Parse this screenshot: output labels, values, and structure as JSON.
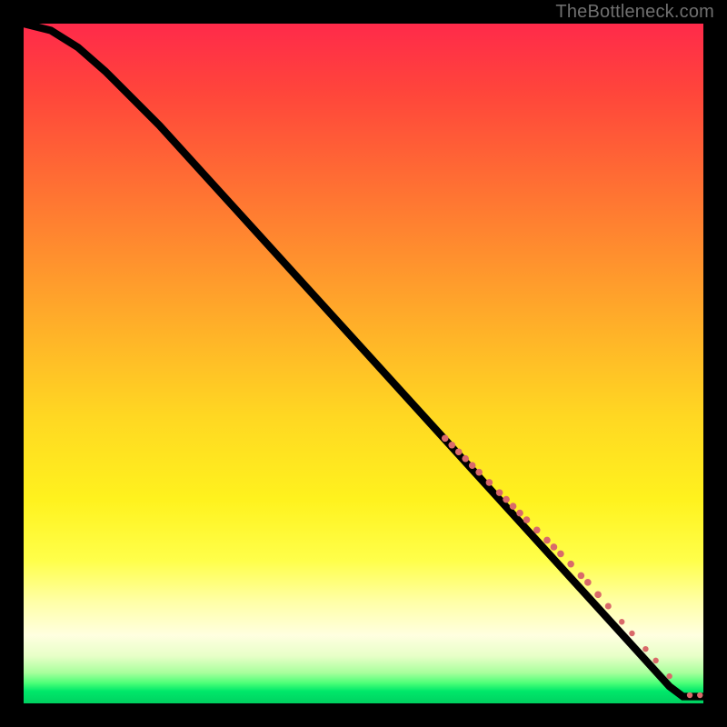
{
  "watermark": "TheBottleneck.com",
  "chart_data": {
    "type": "line",
    "title": "",
    "xlabel": "",
    "ylabel": "",
    "xlim": [
      0,
      100
    ],
    "ylim": [
      0,
      100
    ],
    "curve": [
      {
        "x": 0,
        "y": 100
      },
      {
        "x": 4,
        "y": 99
      },
      {
        "x": 8,
        "y": 96.5
      },
      {
        "x": 12,
        "y": 93
      },
      {
        "x": 20,
        "y": 85
      },
      {
        "x": 30,
        "y": 74
      },
      {
        "x": 40,
        "y": 63
      },
      {
        "x": 50,
        "y": 52
      },
      {
        "x": 60,
        "y": 41
      },
      {
        "x": 70,
        "y": 30
      },
      {
        "x": 80,
        "y": 19
      },
      {
        "x": 90,
        "y": 8
      },
      {
        "x": 95,
        "y": 2.5
      },
      {
        "x": 97,
        "y": 1
      },
      {
        "x": 100,
        "y": 1
      }
    ],
    "highlight_points": [
      {
        "x": 62,
        "y": 39,
        "r": 3.8
      },
      {
        "x": 63,
        "y": 38,
        "r": 3.8
      },
      {
        "x": 64,
        "y": 37,
        "r": 3.8
      },
      {
        "x": 65,
        "y": 36,
        "r": 3.8
      },
      {
        "x": 66,
        "y": 35,
        "r": 3.8
      },
      {
        "x": 67,
        "y": 34,
        "r": 3.8
      },
      {
        "x": 68.5,
        "y": 32.5,
        "r": 3.8
      },
      {
        "x": 70,
        "y": 31,
        "r": 3.8
      },
      {
        "x": 71,
        "y": 30,
        "r": 3.8
      },
      {
        "x": 72,
        "y": 29,
        "r": 3.8
      },
      {
        "x": 73,
        "y": 28,
        "r": 3.8
      },
      {
        "x": 74,
        "y": 27,
        "r": 3.8
      },
      {
        "x": 75.5,
        "y": 25.5,
        "r": 3.8
      },
      {
        "x": 77,
        "y": 24,
        "r": 3.8
      },
      {
        "x": 78,
        "y": 23,
        "r": 3.8
      },
      {
        "x": 79,
        "y": 22,
        "r": 3.8
      },
      {
        "x": 80.5,
        "y": 20.5,
        "r": 3.8
      },
      {
        "x": 82,
        "y": 18.8,
        "r": 3.8
      },
      {
        "x": 83,
        "y": 17.8,
        "r": 3.8
      },
      {
        "x": 84.5,
        "y": 16,
        "r": 3.8
      },
      {
        "x": 86,
        "y": 14.3,
        "r": 3.5
      },
      {
        "x": 88,
        "y": 12,
        "r": 3.2
      },
      {
        "x": 89.5,
        "y": 10.3,
        "r": 3.2
      },
      {
        "x": 91.5,
        "y": 8,
        "r": 3.2
      },
      {
        "x": 93,
        "y": 6.3,
        "r": 3.2
      },
      {
        "x": 95,
        "y": 4,
        "r": 3.2
      },
      {
        "x": 98,
        "y": 1.2,
        "r": 3.2
      },
      {
        "x": 99.5,
        "y": 1.2,
        "r": 3.2
      }
    ],
    "gradient_stops": [
      {
        "pos": 0,
        "color": "#ff2a4a"
      },
      {
        "pos": 0.7,
        "color": "#fff21e"
      },
      {
        "pos": 0.9,
        "color": "#ffffe0"
      },
      {
        "pos": 1.0,
        "color": "#00d060"
      }
    ]
  }
}
